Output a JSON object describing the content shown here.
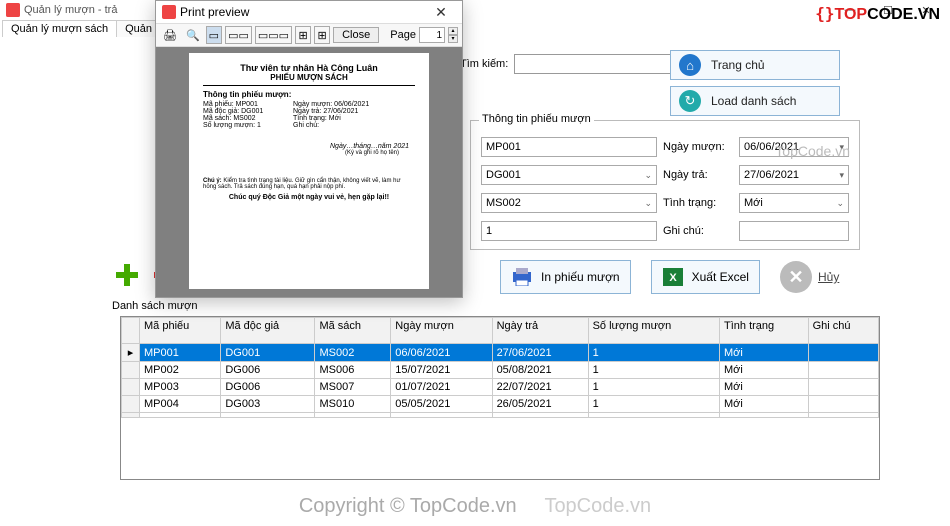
{
  "main": {
    "title": "Quản lý mượn - trả"
  },
  "tabs": {
    "t1": "Quản lý mượn sách",
    "t2": "Quản lý trả sách"
  },
  "logo": {
    "text": "TOPCODE.VN"
  },
  "search": {
    "label": "Tìm kiếm:"
  },
  "buttons": {
    "home": "Trang chủ",
    "load": "Load danh sách",
    "print": "In phiếu mượn",
    "export": "Xuất Excel",
    "cancel": "Hủy"
  },
  "info": {
    "legend": "Thông tin phiếu mượn",
    "maphieu": "MP001",
    "madg": "DG001",
    "masach": "MS002",
    "soluong": "1",
    "ngaymuon_lbl": "Ngày mượn:",
    "ngaymuon": "06/06/2021",
    "ngaytra_lbl": "Ngày trả:",
    "ngaytra": "27/06/2021",
    "tinhtrang_lbl": "Tình trạng:",
    "tinhtrang": "Mới",
    "ghichu_lbl": "Ghi chú:"
  },
  "list_label": "Danh sách mượn",
  "columns": {
    "c1": "Mã phiếu",
    "c2": "Mã độc giả",
    "c3": "Mã sách",
    "c4": "Ngày mượn",
    "c5": "Ngày trả",
    "c6": "Số lượng mượn",
    "c7": "Tình trạng",
    "c8": "Ghi chú"
  },
  "rows": [
    {
      "c1": "MP001",
      "c2": "DG001",
      "c3": "MS002",
      "c4": "06/06/2021",
      "c5": "27/06/2021",
      "c6": "1",
      "c7": "Mới",
      "c8": ""
    },
    {
      "c1": "MP002",
      "c2": "DG006",
      "c3": "MS006",
      "c4": "15/07/2021",
      "c5": "05/08/2021",
      "c6": "1",
      "c7": "Mới",
      "c8": ""
    },
    {
      "c1": "MP003",
      "c2": "DG006",
      "c3": "MS007",
      "c4": "01/07/2021",
      "c5": "22/07/2021",
      "c6": "1",
      "c7": "Mới",
      "c8": ""
    },
    {
      "c1": "MP004",
      "c2": "DG003",
      "c3": "MS010",
      "c4": "05/05/2021",
      "c5": "26/05/2021",
      "c6": "1",
      "c7": "Mới",
      "c8": ""
    }
  ],
  "preview": {
    "title": "Print preview",
    "close_btn": "Close",
    "page_label": "Page",
    "page_num": "1",
    "doc": {
      "h1": "Thư viên tư nhân Hà Công Luân",
      "h2": "PHIẾU MƯỢN SÁCH",
      "sect": "Thông tin phiếu mượn:",
      "k1": "Mã phiếu: MP001",
      "v1": "Ngày mượn: 06/06/2021",
      "k2": "Mã độc giả: DG001",
      "v2": "Ngày trả: 27/06/2021",
      "k3": "Mã sách: MS002",
      "v3": "Tình trạng: Mới",
      "k4": "Số lượng mượn: 1",
      "v4": "Ghi chú:",
      "sig": "Ngày…tháng…năm 2021",
      "sig2": "(Ký và ghi rõ họ tên)",
      "note_b": "Chú ý:",
      "note": " Kiểm tra tình trạng tài liệu. Giữ gìn cẩn thận, không viết vẽ, làm hư hỏng sách. Trả sách đúng hạn, quá hạn phải nộp phí.",
      "thanks": "Chúc quý Độc Giả một ngày vui vẻ, hẹn gặp lại!!"
    }
  },
  "watermark": "Copyright © TopCode.vn",
  "wm2": "TopCode.vn",
  "wm3": "TopCode.vn"
}
